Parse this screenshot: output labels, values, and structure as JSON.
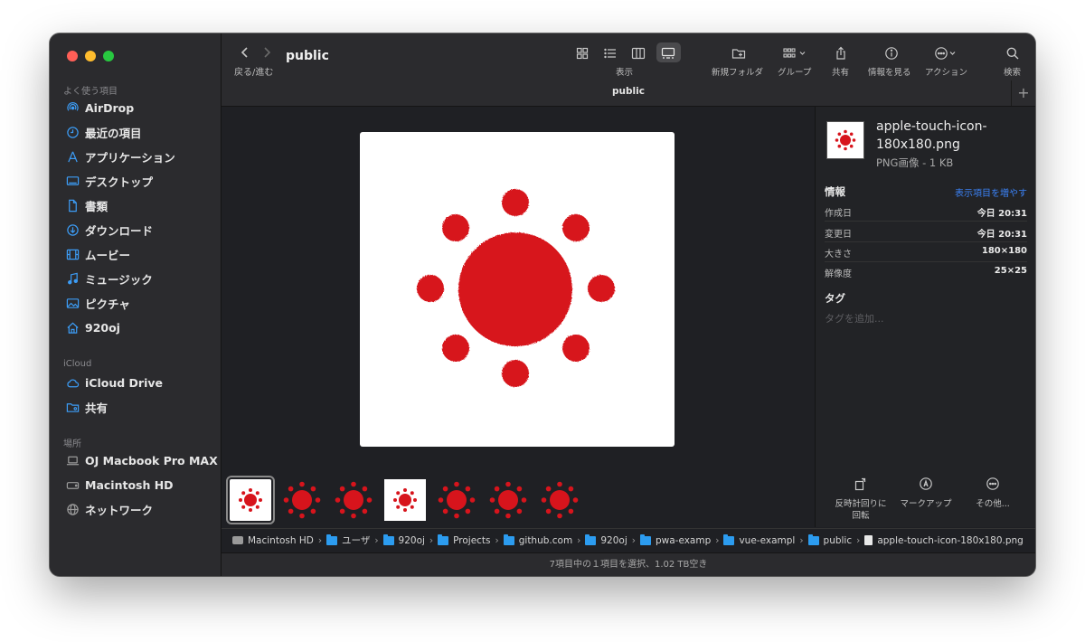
{
  "sidebar": {
    "sections": {
      "favorites": "よく使う項目",
      "icloud": "iCloud",
      "locations": "場所"
    },
    "favorites": [
      {
        "label": "AirDrop",
        "icon": "airdrop-icon"
      },
      {
        "label": "最近の項目",
        "icon": "clock-icon"
      },
      {
        "label": "アプリケーション",
        "icon": "applications-icon"
      },
      {
        "label": "デスクトップ",
        "icon": "desktop-icon"
      },
      {
        "label": "書類",
        "icon": "document-icon"
      },
      {
        "label": "ダウンロード",
        "icon": "download-icon"
      },
      {
        "label": "ムービー",
        "icon": "film-icon"
      },
      {
        "label": "ミュージック",
        "icon": "music-icon"
      },
      {
        "label": "ピクチャ",
        "icon": "photo-icon"
      },
      {
        "label": "920oj",
        "icon": "home-icon"
      }
    ],
    "icloud": [
      {
        "label": "iCloud Drive",
        "icon": "cloud-icon"
      },
      {
        "label": "共有",
        "icon": "shared-folder-icon"
      }
    ],
    "locations": [
      {
        "label": "OJ Macbook Pro MAX",
        "icon": "laptop-icon"
      },
      {
        "label": "Macintosh HD",
        "icon": "disk-icon"
      },
      {
        "label": "ネットワーク",
        "icon": "globe-icon"
      }
    ]
  },
  "toolbar": {
    "back_forward_label": "戻る/進む",
    "window_title": "public",
    "view_label": "表示",
    "new_folder_label": "新規フォルダ",
    "group_label": "グループ",
    "share_label": "共有",
    "info_label": "情報を見る",
    "action_label": "アクション",
    "search_label": "検索"
  },
  "tab": {
    "title": "public",
    "add": "+"
  },
  "inspector": {
    "file_name": "apple-touch-icon-180x180.png",
    "file_type": "PNG画像 - 1 KB",
    "info_heading": "情報",
    "show_more": "表示項目を増やす",
    "rows": [
      {
        "key": "作成日",
        "value": "今日 20:31"
      },
      {
        "key": "変更日",
        "value": "今日 20:31"
      },
      {
        "key": "大きさ",
        "value": "180×180"
      },
      {
        "key": "解像度",
        "value": "25×25"
      }
    ],
    "tags_heading": "タグ",
    "tags_placeholder": "タグを追加...",
    "actions": {
      "rotate": "反時計回りに回転",
      "markup": "マークアップ",
      "more": "その他..."
    }
  },
  "path": [
    {
      "label": "Macintosh HD",
      "kind": "disk"
    },
    {
      "label": "ユーザ",
      "kind": "folder"
    },
    {
      "label": "920oj",
      "kind": "folder"
    },
    {
      "label": "Projects",
      "kind": "folder"
    },
    {
      "label": "github.com",
      "kind": "folder"
    },
    {
      "label": "920oj",
      "kind": "folder"
    },
    {
      "label": "pwa-examp",
      "kind": "folder"
    },
    {
      "label": "vue-exampl",
      "kind": "folder"
    },
    {
      "label": "public",
      "kind": "folder"
    },
    {
      "label": "apple-touch-icon-180x180.png",
      "kind": "file"
    }
  ],
  "status": "7項目中の１項目を選択、1.02 TB空き",
  "colors": {
    "icon_red": "#d7141c",
    "accent_blue": "#3b82f6",
    "sidebar_icon_blue": "#3c9cf5"
  }
}
